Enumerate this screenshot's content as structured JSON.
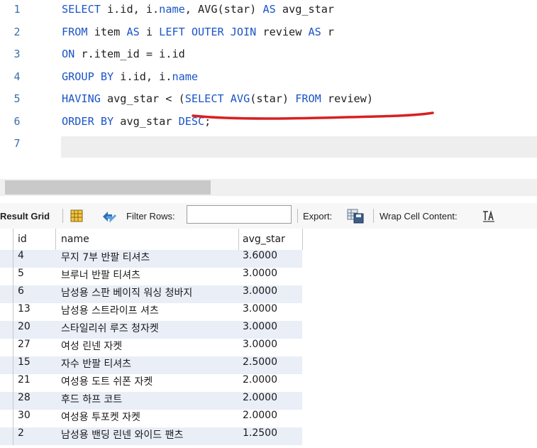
{
  "editor": {
    "line_numbers": [
      "1",
      "2",
      "3",
      "4",
      "5",
      "6",
      "7"
    ],
    "lines": [
      [
        {
          "t": "SELECT ",
          "k": 1
        },
        {
          "t": "i.id, i."
        },
        {
          "t": "name",
          "k": 1
        },
        {
          "t": ", AVG(star) "
        },
        {
          "t": "AS",
          "k": 1
        },
        {
          "t": " avg_star"
        }
      ],
      [
        {
          "t": "FROM ",
          "k": 1
        },
        {
          "t": "item "
        },
        {
          "t": "AS",
          "k": 1
        },
        {
          "t": " i "
        },
        {
          "t": "LEFT OUTER JOIN",
          "k": 1
        },
        {
          "t": " review "
        },
        {
          "t": "AS",
          "k": 1
        },
        {
          "t": " r"
        }
      ],
      [
        {
          "t": "ON ",
          "k": 1
        },
        {
          "t": "r.item_id = i.id"
        }
      ],
      [
        {
          "t": "GROUP BY ",
          "k": 1
        },
        {
          "t": "i.id, i."
        },
        {
          "t": "name",
          "k": 1
        }
      ],
      [
        {
          "t": "HAVING ",
          "k": 1
        },
        {
          "t": "avg_star < ("
        },
        {
          "t": "SELECT",
          "k": 1
        },
        {
          "t": " "
        },
        {
          "t": "AVG",
          "k": 1
        },
        {
          "t": "(star) "
        },
        {
          "t": "FROM",
          "k": 1
        },
        {
          "t": " review)"
        }
      ],
      [
        {
          "t": "ORDER BY ",
          "k": 1
        },
        {
          "t": "avg_star "
        },
        {
          "t": "DESC",
          "k": 1
        },
        {
          "t": ";"
        }
      ],
      []
    ],
    "annotation_color": "#d92020"
  },
  "toolbar": {
    "result_grid_label": "Result Grid",
    "filter_rows_label": "Filter Rows:",
    "filter_value": "",
    "export_label": "Export:",
    "wrap_label": "Wrap Cell Content:",
    "icons": [
      "grid-view-icon",
      "refresh-icon",
      "export-icon",
      "wrap-cell-icon"
    ]
  },
  "grid": {
    "columns": [
      "id",
      "name",
      "avg_star"
    ],
    "rows": [
      [
        "4",
        "무지 7부 반팔 티셔츠",
        "3.6000"
      ],
      [
        "5",
        "브루너 반팔 티셔츠",
        "3.0000"
      ],
      [
        "6",
        "남성용 스판 베이직 워싱 청바지",
        "3.0000"
      ],
      [
        "13",
        "남성용 스트라이프 셔츠",
        "3.0000"
      ],
      [
        "20",
        "스타일리쉬 루즈 청자켓",
        "3.0000"
      ],
      [
        "27",
        "여성 린넨 자켓",
        "3.0000"
      ],
      [
        "15",
        "자수 반팔 티셔츠",
        "2.5000"
      ],
      [
        "21",
        "여성용 도트 쉬폰 자켓",
        "2.0000"
      ],
      [
        "28",
        "후드 하프 코트",
        "2.0000"
      ],
      [
        "30",
        "여성용 투포켓 자켓",
        "2.0000"
      ],
      [
        "2",
        "남성용 밴딩 린넨 와이드 팬츠",
        "1.2500"
      ]
    ]
  }
}
